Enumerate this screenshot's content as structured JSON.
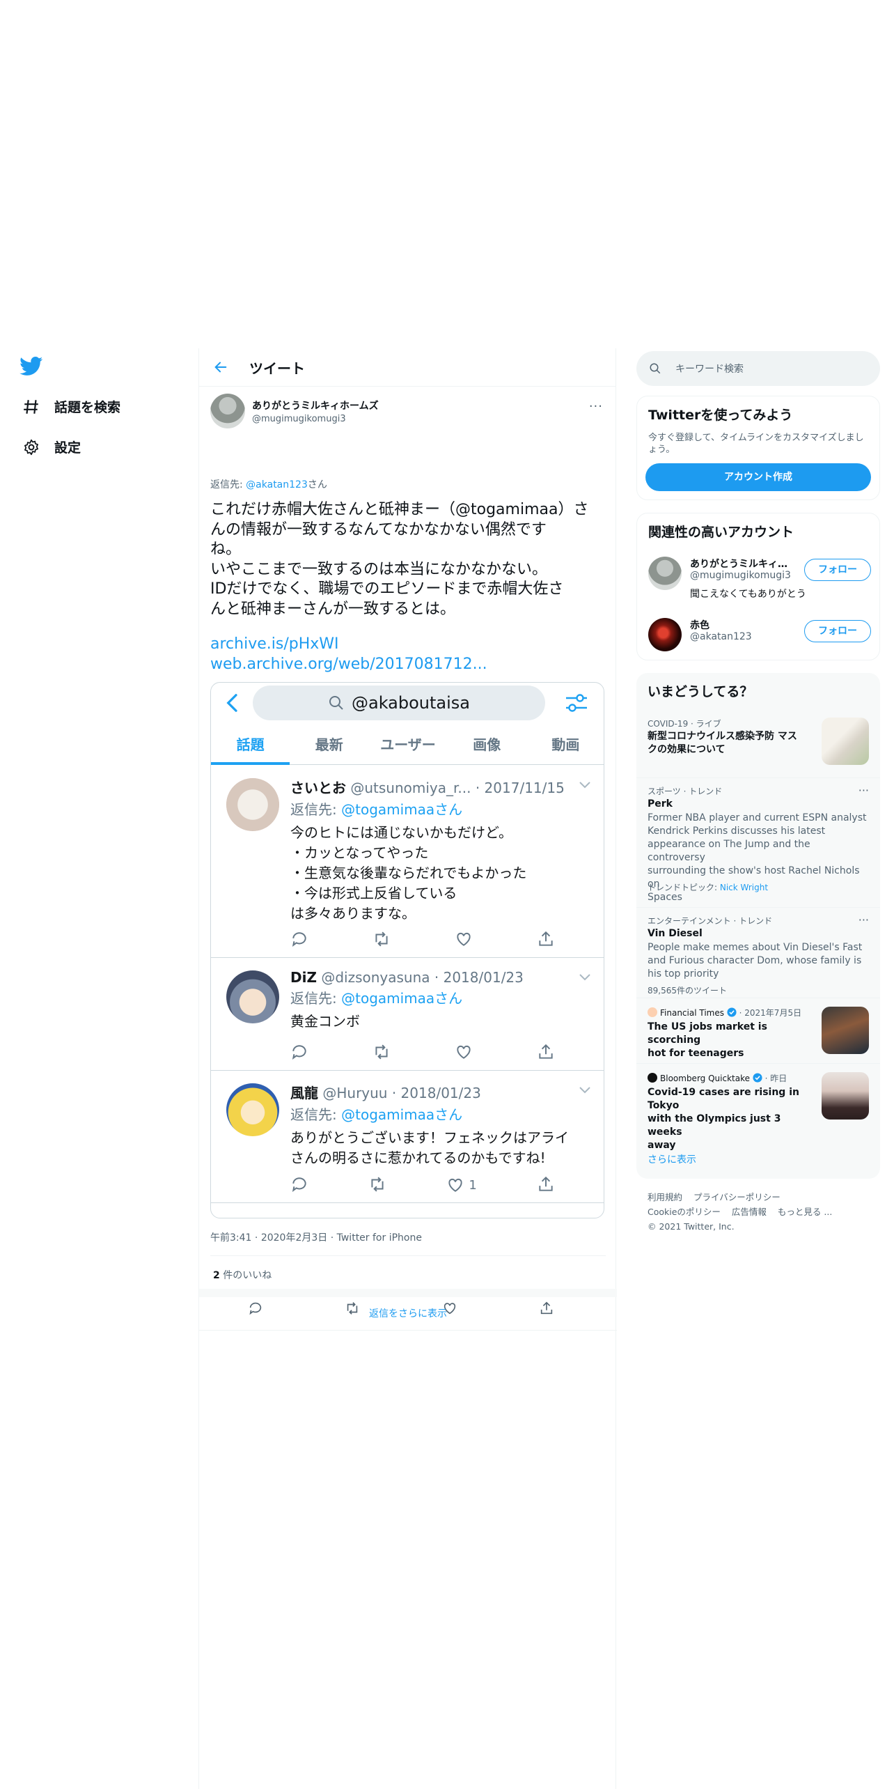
{
  "nav": {
    "explore_label": "話題を検索",
    "settings_label": "設定"
  },
  "header": {
    "title": "ツイート"
  },
  "tweet": {
    "author_name": "ありがとうミルキィホームズ",
    "author_handle": "@mugimugikomugi3",
    "reply_prefix": "返信先: ",
    "reply_to": "@akatan123",
    "reply_suffix": "さん",
    "text_lines": [
      "これだけ赤帽大佐さんと砥神まー（@togamimaa）さ",
      "んの情報が一致するなんてなかなかない偶然です",
      "ね。",
      "いやここまで一致するのは本当になかなかない。",
      "IDだけでなく、職場でのエピソードまで赤帽大佐さ",
      "んと砥神まーさんが一致するとは。"
    ],
    "links": [
      "archive.is/pHxWI",
      "web.archive.org/web/2017081712..."
    ],
    "time": "午前3:41",
    "date": "2020年2月3日",
    "client": "Twitter for iPhone",
    "likes_count": "2",
    "likes_label": " 件のいいね",
    "more_replies": "返信をさらに表示"
  },
  "embed": {
    "search_query": "@akaboutaisa",
    "tabs": [
      "話題",
      "最新",
      "ユーザー",
      "画像",
      "動画"
    ],
    "tweets": [
      {
        "name": "さいとお",
        "handle": "@utsunomiya_r...",
        "date": "· 2017/11/15",
        "reply_prefix": "返信先: ",
        "reply_to": "@togamimaaさん",
        "lines": [
          "今のヒトには通じないかもだけど。",
          "・カッとなってやった",
          "・生意気な後輩ならだれでもよかった",
          "・今は形式上反省している",
          "は多々ありますな。"
        ],
        "like_count": ""
      },
      {
        "name": "DiZ",
        "handle": "@dizsonyasuna",
        "date": "· 2018/01/23",
        "reply_prefix": "返信先: ",
        "reply_to": "@togamimaaさん",
        "lines": [
          "黄金コンボ"
        ],
        "like_count": ""
      },
      {
        "name": "風龍",
        "handle": "@Huryuu",
        "date": "· 2018/01/23",
        "reply_prefix": "返信先: ",
        "reply_to": "@togamimaaさん",
        "lines": [
          "ありがとうございます！フェネックはアライ",
          "さんの明るさに惹かれてるのかもですね!"
        ],
        "like_count": "1"
      }
    ]
  },
  "sidebar": {
    "search_placeholder": "キーワード検索",
    "signup": {
      "title": "Twitterを使ってみよう",
      "desc": "今すぐ登録して、タイムラインをカスタマイズしましょう。",
      "button": "アカウント作成"
    },
    "who_to_follow": {
      "title": "関連性の高いアカウント",
      "accounts": [
        {
          "name": "ありがとうミルキィホ...",
          "handle": "@mugimugikomugi3",
          "bio": "聞こえなくてもありがとう",
          "button": "フォロー"
        },
        {
          "name": "赤色",
          "handle": "@akatan123",
          "bio": "",
          "button": "フォロー"
        }
      ]
    },
    "trends": {
      "title": "いまどうしてる？",
      "items": [
        {
          "category": "COVID-19 · ライブ",
          "title_lines": [
            "新型コロナウイルス感染予防 マス",
            "クの効果について"
          ]
        },
        {
          "category": "スポーツ · トレンド",
          "title": "Perk",
          "desc_lines": [
            "Former NBA player and current ESPN analyst",
            "Kendrick Perkins discusses his latest",
            "appearance on The Jump and the controversy",
            "surrounding the show's host Rachel Nichols on",
            "Spaces"
          ],
          "sub_prefix": "トレンドトピック: ",
          "sub_link": "Nick Wright"
        },
        {
          "category": "エンターテインメント · トレンド",
          "title": "Vin Diesel",
          "desc_lines": [
            "People make memes about Vin Diesel's Fast",
            "and Furious character Dom, whose family is",
            "his top priority"
          ],
          "sub": "89,565件のツイート"
        },
        {
          "source": "Financial Times",
          "time": "· 2021年7月5日",
          "title_lines": [
            "The US jobs market is scorching",
            "hot for teenagers"
          ]
        },
        {
          "source": "Bloomberg Quicktake",
          "time": "· 昨日",
          "title_lines": [
            "Covid-19 cases are rising in Tokyo",
            "with the Olympics just 3 weeks",
            "away"
          ]
        }
      ],
      "show_more": "さらに表示"
    },
    "footer": {
      "links_line1": [
        "利用規約",
        "プライバシーポリシー"
      ],
      "links_line2": [
        "Cookieのポリシー",
        "広告情報",
        "もっと見る ..."
      ],
      "copyright": "© 2021 Twitter, Inc."
    }
  },
  "colors": {
    "accent": "#1d9bf0",
    "embed_accent": "#1da1f2",
    "muted": "#536471"
  }
}
